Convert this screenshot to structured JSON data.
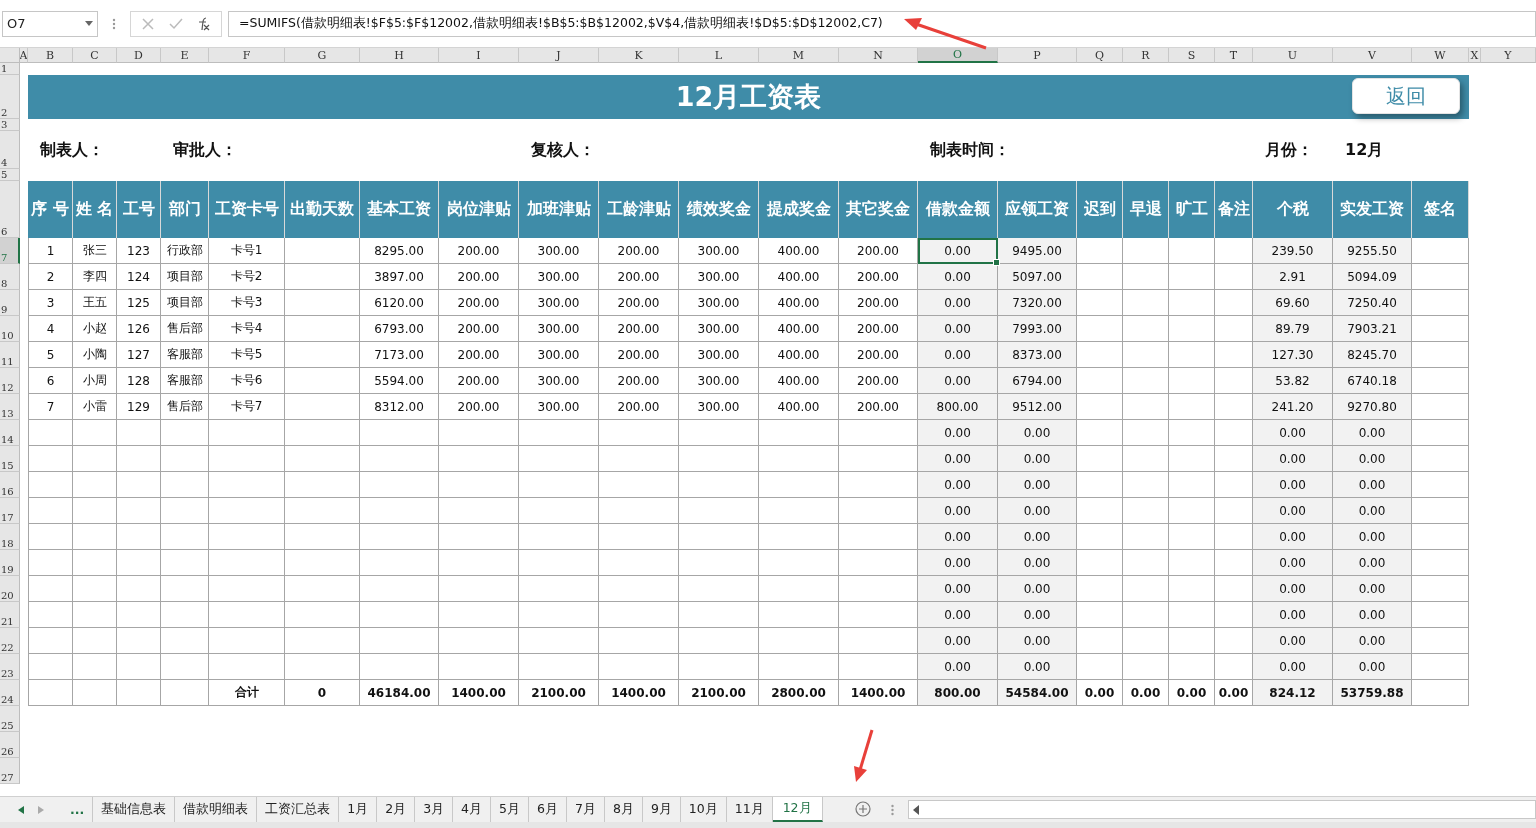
{
  "formula_bar": {
    "name_box": "O7",
    "formula": "=SUMIFS(借款明细表!$F$5:$F$12002,借款明细表!$B$5:$B$12002,$V$4,借款明细表!$D$5:$D$12002,C7)"
  },
  "column_headers": [
    {
      "label": "A",
      "selected": false
    },
    {
      "label": "B",
      "selected": false
    },
    {
      "label": "C",
      "selected": false
    },
    {
      "label": "D",
      "selected": false
    },
    {
      "label": "E",
      "selected": false
    },
    {
      "label": "F",
      "selected": false
    },
    {
      "label": "G",
      "selected": false
    },
    {
      "label": "H",
      "selected": false
    },
    {
      "label": "I",
      "selected": false
    },
    {
      "label": "J",
      "selected": false
    },
    {
      "label": "K",
      "selected": false
    },
    {
      "label": "L",
      "selected": false
    },
    {
      "label": "M",
      "selected": false
    },
    {
      "label": "N",
      "selected": false
    },
    {
      "label": "O",
      "selected": true
    },
    {
      "label": "P",
      "selected": false
    },
    {
      "label": "Q",
      "selected": false
    },
    {
      "label": "R",
      "selected": false
    },
    {
      "label": "S",
      "selected": false
    },
    {
      "label": "T",
      "selected": false
    },
    {
      "label": "U",
      "selected": false
    },
    {
      "label": "V",
      "selected": false
    },
    {
      "label": "W",
      "selected": false
    },
    {
      "label": "X",
      "selected": false
    },
    {
      "label": "Y",
      "selected": false
    }
  ],
  "row_numbers": [
    {
      "label": "1",
      "selected": false
    },
    {
      "label": "2",
      "selected": false
    },
    {
      "label": "3",
      "selected": false
    },
    {
      "label": "4",
      "selected": false
    },
    {
      "label": "5",
      "selected": false
    },
    {
      "label": "6",
      "selected": false
    },
    {
      "label": "7",
      "selected": true
    },
    {
      "label": "8",
      "selected": false
    },
    {
      "label": "9",
      "selected": false
    },
    {
      "label": "10",
      "selected": false
    },
    {
      "label": "11",
      "selected": false
    },
    {
      "label": "12",
      "selected": false
    },
    {
      "label": "13",
      "selected": false
    },
    {
      "label": "14",
      "selected": false
    },
    {
      "label": "15",
      "selected": false
    },
    {
      "label": "16",
      "selected": false
    },
    {
      "label": "17",
      "selected": false
    },
    {
      "label": "18",
      "selected": false
    },
    {
      "label": "19",
      "selected": false
    },
    {
      "label": "20",
      "selected": false
    },
    {
      "label": "21",
      "selected": false
    },
    {
      "label": "22",
      "selected": false
    },
    {
      "label": "23",
      "selected": false
    },
    {
      "label": "24",
      "selected": false
    },
    {
      "label": "25",
      "selected": false
    },
    {
      "label": "26",
      "selected": false
    },
    {
      "label": "27",
      "selected": false
    }
  ],
  "title": "12月工资表",
  "return_button": "返回",
  "info_labels": [
    "制表人：",
    "审批人：",
    "复核人：",
    "制表时间：",
    "月份：",
    "12月"
  ],
  "table": {
    "columns": [
      {
        "label": "序 号",
        "shaded": false
      },
      {
        "label": "姓 名",
        "shaded": false
      },
      {
        "label": "工号",
        "shaded": false
      },
      {
        "label": "部门",
        "shaded": false
      },
      {
        "label": "工资卡号",
        "shaded": false
      },
      {
        "label": "出勤天数",
        "shaded": false
      },
      {
        "label": "基本工资",
        "shaded": false
      },
      {
        "label": "岗位津贴",
        "shaded": false
      },
      {
        "label": "加班津贴",
        "shaded": false
      },
      {
        "label": "工龄津贴",
        "shaded": false
      },
      {
        "label": "绩效奖金",
        "shaded": false
      },
      {
        "label": "提成奖金",
        "shaded": false
      },
      {
        "label": "其它奖金",
        "shaded": false
      },
      {
        "label": "借款金额",
        "shaded": true
      },
      {
        "label": "应领工资",
        "shaded": true
      },
      {
        "label": "迟到",
        "shaded": false
      },
      {
        "label": "早退",
        "shaded": false
      },
      {
        "label": "旷工",
        "shaded": false
      },
      {
        "label": "备注",
        "shaded": false
      },
      {
        "label": "个税",
        "shaded": true
      },
      {
        "label": "实发工资",
        "shaded": true
      },
      {
        "label": "签名",
        "shaded": false
      }
    ],
    "rows": [
      {
        "kind": "data",
        "cells": {
          "B": "1",
          "C": "张三",
          "D": "123",
          "E": "行政部",
          "F": "卡号1",
          "H": "8295.00",
          "I": "200.00",
          "J": "300.00",
          "K": "200.00",
          "L": "300.00",
          "M": "400.00",
          "N": "200.00",
          "O": "0.00",
          "P": "9495.00",
          "U": "239.50",
          "V": "9255.50"
        }
      },
      {
        "kind": "data",
        "cells": {
          "B": "2",
          "C": "李四",
          "D": "124",
          "E": "项目部",
          "F": "卡号2",
          "H": "3897.00",
          "I": "200.00",
          "J": "300.00",
          "K": "200.00",
          "L": "300.00",
          "M": "400.00",
          "N": "200.00",
          "O": "0.00",
          "P": "5097.00",
          "U": "2.91",
          "V": "5094.09"
        }
      },
      {
        "kind": "data",
        "cells": {
          "B": "3",
          "C": "王五",
          "D": "125",
          "E": "项目部",
          "F": "卡号3",
          "H": "6120.00",
          "I": "200.00",
          "J": "300.00",
          "K": "200.00",
          "L": "300.00",
          "M": "400.00",
          "N": "200.00",
          "O": "0.00",
          "P": "7320.00",
          "U": "69.60",
          "V": "7250.40"
        }
      },
      {
        "kind": "data",
        "cells": {
          "B": "4",
          "C": "小赵",
          "D": "126",
          "E": "售后部",
          "F": "卡号4",
          "H": "6793.00",
          "I": "200.00",
          "J": "300.00",
          "K": "200.00",
          "L": "300.00",
          "M": "400.00",
          "N": "200.00",
          "O": "0.00",
          "P": "7993.00",
          "U": "89.79",
          "V": "7903.21"
        }
      },
      {
        "kind": "data",
        "cells": {
          "B": "5",
          "C": "小陶",
          "D": "127",
          "E": "客服部",
          "F": "卡号5",
          "H": "7173.00",
          "I": "200.00",
          "J": "300.00",
          "K": "200.00",
          "L": "300.00",
          "M": "400.00",
          "N": "200.00",
          "O": "0.00",
          "P": "8373.00",
          "U": "127.30",
          "V": "8245.70"
        }
      },
      {
        "kind": "data",
        "cells": {
          "B": "6",
          "C": "小周",
          "D": "128",
          "E": "客服部",
          "F": "卡号6",
          "H": "5594.00",
          "I": "200.00",
          "J": "300.00",
          "K": "200.00",
          "L": "300.00",
          "M": "400.00",
          "N": "200.00",
          "O": "0.00",
          "P": "6794.00",
          "U": "53.82",
          "V": "6740.18"
        }
      },
      {
        "kind": "data",
        "cells": {
          "B": "7",
          "C": "小雷",
          "D": "129",
          "E": "售后部",
          "F": "卡号7",
          "H": "8312.00",
          "I": "200.00",
          "J": "300.00",
          "K": "200.00",
          "L": "300.00",
          "M": "400.00",
          "N": "200.00",
          "O": "800.00",
          "P": "9512.00",
          "U": "241.20",
          "V": "9270.80"
        }
      },
      {
        "kind": "data",
        "cells": {
          "O": "0.00",
          "P": "0.00",
          "U": "0.00",
          "V": "0.00"
        }
      },
      {
        "kind": "data",
        "cells": {
          "O": "0.00",
          "P": "0.00",
          "U": "0.00",
          "V": "0.00"
        }
      },
      {
        "kind": "data",
        "cells": {
          "O": "0.00",
          "P": "0.00",
          "U": "0.00",
          "V": "0.00"
        }
      },
      {
        "kind": "data",
        "cells": {
          "O": "0.00",
          "P": "0.00",
          "U": "0.00",
          "V": "0.00"
        }
      },
      {
        "kind": "data",
        "cells": {
          "O": "0.00",
          "P": "0.00",
          "U": "0.00",
          "V": "0.00"
        }
      },
      {
        "kind": "data",
        "cells": {
          "O": "0.00",
          "P": "0.00",
          "U": "0.00",
          "V": "0.00"
        }
      },
      {
        "kind": "data",
        "cells": {
          "O": "0.00",
          "P": "0.00",
          "U": "0.00",
          "V": "0.00"
        }
      },
      {
        "kind": "data",
        "cells": {
          "O": "0.00",
          "P": "0.00",
          "U": "0.00",
          "V": "0.00"
        }
      },
      {
        "kind": "data",
        "cells": {
          "O": "0.00",
          "P": "0.00",
          "U": "0.00",
          "V": "0.00"
        }
      },
      {
        "kind": "data",
        "cells": {
          "O": "0.00",
          "P": "0.00",
          "U": "0.00",
          "V": "0.00"
        }
      },
      {
        "kind": "total",
        "cells": {
          "F": "合计",
          "G": "0",
          "H": "46184.00",
          "I": "1400.00",
          "J": "2100.00",
          "K": "1400.00",
          "L": "2100.00",
          "M": "2800.00",
          "N": "1400.00",
          "O": "800.00",
          "P": "54584.00",
          "Q": "0.00",
          "R": "0.00",
          "S": "0.00",
          "T": "0.00",
          "U": "824.12",
          "V": "53759.88"
        }
      }
    ]
  },
  "sheet_tabs": [
    {
      "label": "...",
      "selected": false
    },
    {
      "label": "基础信息表",
      "selected": false
    },
    {
      "label": "借款明细表",
      "selected": false
    },
    {
      "label": "工资汇总表",
      "selected": false
    },
    {
      "label": "1月",
      "selected": false
    },
    {
      "label": "2月",
      "selected": false
    },
    {
      "label": "3月",
      "selected": false
    },
    {
      "label": "4月",
      "selected": false
    },
    {
      "label": "5月",
      "selected": false
    },
    {
      "label": "6月",
      "selected": false
    },
    {
      "label": "7月",
      "selected": false
    },
    {
      "label": "8月",
      "selected": false
    },
    {
      "label": "9月",
      "selected": false
    },
    {
      "label": "10月",
      "selected": false
    },
    {
      "label": "11月",
      "selected": false
    },
    {
      "label": "12月",
      "selected": true
    }
  ]
}
